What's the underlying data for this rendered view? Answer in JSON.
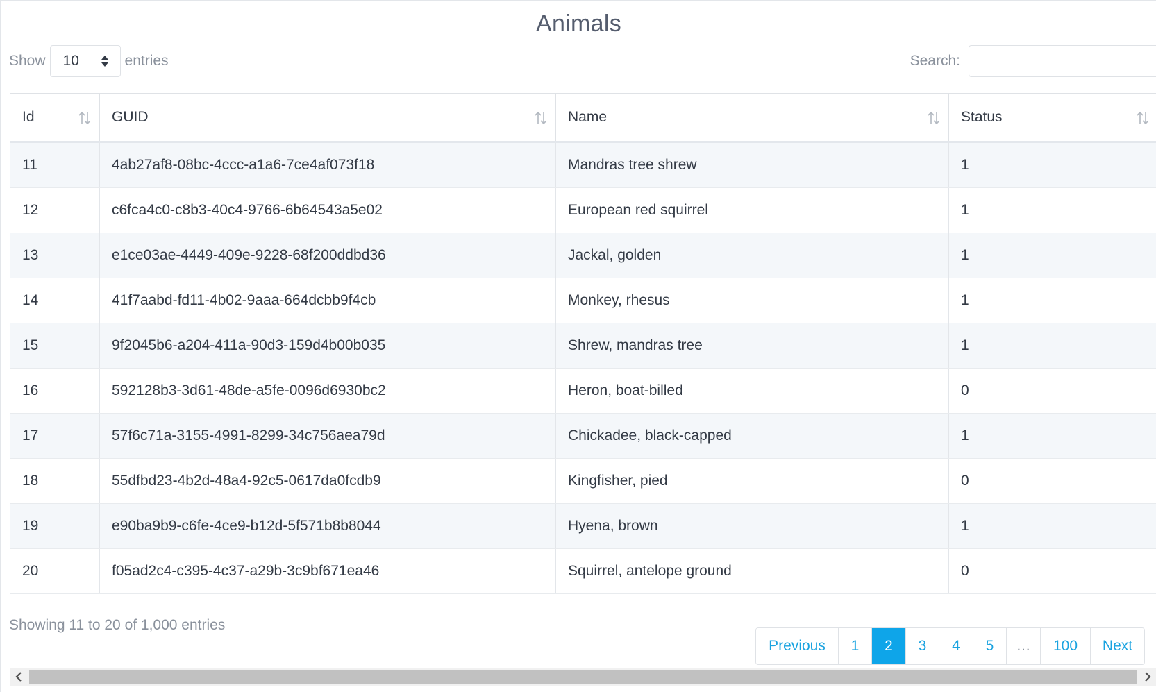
{
  "title": "Animals",
  "length": {
    "show_label": "Show",
    "selected": "10",
    "entries_label": "entries"
  },
  "search": {
    "label": "Search:",
    "value": ""
  },
  "table": {
    "columns": [
      "Id",
      "GUID",
      "Name",
      "Status"
    ],
    "rows": [
      [
        "11",
        "4ab27af8-08bc-4ccc-a1a6-7ce4af073f18",
        "Mandras tree shrew",
        "1"
      ],
      [
        "12",
        "c6fca4c0-c8b3-40c4-9766-6b64543a5e02",
        "European red squirrel",
        "1"
      ],
      [
        "13",
        "e1ce03ae-4449-409e-9228-68f200ddbd36",
        "Jackal, golden",
        "1"
      ],
      [
        "14",
        "41f7aabd-fd11-4b02-9aaa-664dcbb9f4cb",
        "Monkey, rhesus",
        "1"
      ],
      [
        "15",
        "9f2045b6-a204-411a-90d3-159d4b00b035",
        "Shrew, mandras tree",
        "1"
      ],
      [
        "16",
        "592128b3-3d61-48de-a5fe-0096d6930bc2",
        "Heron, boat-billed",
        "0"
      ],
      [
        "17",
        "57f6c71a-3155-4991-8299-34c756aea79d",
        "Chickadee, black-capped",
        "1"
      ],
      [
        "18",
        "55dfbd23-4b2d-48a4-92c5-0617da0fcdb9",
        "Kingfisher, pied",
        "0"
      ],
      [
        "19",
        "e90ba9b9-c6fe-4ce9-b12d-5f571b8b8044",
        "Hyena, brown",
        "1"
      ],
      [
        "20",
        "f05ad2c4-c395-4c37-a29b-3c9bf671ea46",
        "Squirrel, antelope ground",
        "0"
      ]
    ]
  },
  "info": "Showing 11 to 20 of 1,000 entries",
  "pagination": {
    "previous": "Previous",
    "pages": [
      "1",
      "2",
      "3",
      "4",
      "5",
      "…",
      "100"
    ],
    "active": "2",
    "next": "Next"
  },
  "colors": {
    "accent": "#0ea5e9",
    "link": "#1aa3e0",
    "muted_text": "#8a919c",
    "stripe": "#f4f7fa"
  },
  "icons": {
    "sort": "sort-icon",
    "select_arrows": "select-arrows-icon",
    "scroll_left": "scroll-left-icon",
    "scroll_right": "scroll-right-icon"
  }
}
